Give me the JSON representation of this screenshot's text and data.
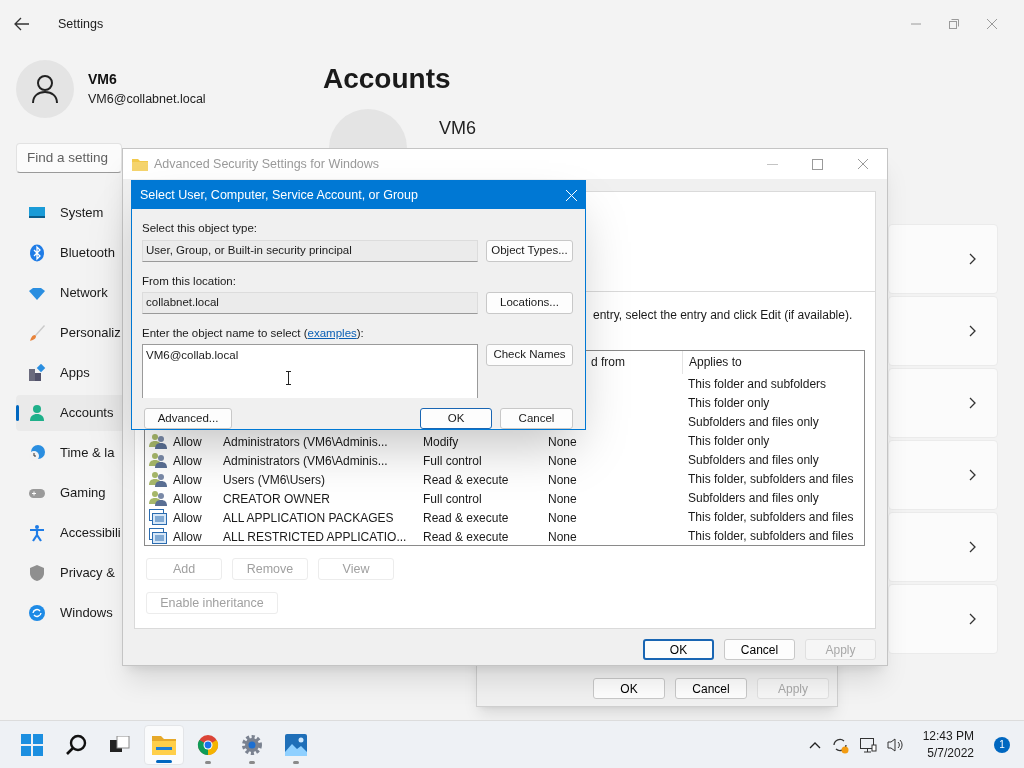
{
  "settings": {
    "title": "Settings",
    "user": {
      "name": "VM6",
      "email": "VM6@collabnet.local"
    },
    "search": {
      "placeholder": "Find a setting"
    },
    "nav": [
      {
        "label": "System",
        "selected": false
      },
      {
        "label": "Bluetooth",
        "selected": false
      },
      {
        "label": "Network",
        "selected": false
      },
      {
        "label": "Personaliz",
        "selected": false
      },
      {
        "label": "Apps",
        "selected": false
      },
      {
        "label": "Accounts",
        "selected": true
      },
      {
        "label": "Time & la",
        "selected": false
      },
      {
        "label": "Gaming",
        "selected": false
      },
      {
        "label": "Accessibili",
        "selected": false
      },
      {
        "label": "Privacy &",
        "selected": false
      },
      {
        "label": "Windows",
        "selected": false
      }
    ],
    "heading": "Accounts",
    "profile_name": "VM6"
  },
  "back_dialog": {
    "buttons": [
      {
        "label": "OK",
        "disabled": false,
        "default": false
      },
      {
        "label": "Cancel",
        "disabled": false,
        "default": false
      },
      {
        "label": "Apply",
        "disabled": true,
        "default": false
      }
    ]
  },
  "advanced_window": {
    "title": "Advanced Security Settings for Windows",
    "instruction": "entry, select the entry and click Edit (if available).",
    "columns": [
      "d from",
      "Applies to"
    ],
    "rows": [
      {
        "applies_to": "This folder and subfolders"
      },
      {
        "applies_to": "This folder only"
      },
      {
        "applies_to": "Subfolders and files only"
      },
      {
        "kind": "group",
        "type": "Allow",
        "principal": "Administrators (VM6\\Adminis...",
        "access": "Modify",
        "inherited": "None",
        "applies_to": "This folder only"
      },
      {
        "kind": "group",
        "type": "Allow",
        "principal": "Administrators (VM6\\Adminis...",
        "access": "Full control",
        "inherited": "None",
        "applies_to": "Subfolders and files only"
      },
      {
        "kind": "group",
        "type": "Allow",
        "principal": "Users (VM6\\Users)",
        "access": "Read & execute",
        "inherited": "None",
        "applies_to": "This folder, subfolders and files"
      },
      {
        "kind": "group",
        "type": "Allow",
        "principal": "CREATOR OWNER",
        "access": "Full control",
        "inherited": "None",
        "applies_to": "Subfolders and files only"
      },
      {
        "kind": "package",
        "type": "Allow",
        "principal": "ALL APPLICATION PACKAGES",
        "access": "Read & execute",
        "inherited": "None",
        "applies_to": "This folder, subfolders and files"
      },
      {
        "kind": "package",
        "type": "Allow",
        "principal": "ALL RESTRICTED APPLICATIO...",
        "access": "Read & execute",
        "inherited": "None",
        "applies_to": "This folder, subfolders and files"
      }
    ],
    "row_buttons": [
      {
        "label": "Add",
        "disabled": true
      },
      {
        "label": "Remove",
        "disabled": true
      },
      {
        "label": "View",
        "disabled": true
      }
    ],
    "inheritance_button": {
      "label": "Enable inheritance",
      "disabled": true
    },
    "buttons": [
      {
        "label": "OK",
        "disabled": false,
        "default": true
      },
      {
        "label": "Cancel",
        "disabled": false,
        "default": false
      },
      {
        "label": "Apply",
        "disabled": true,
        "default": false
      }
    ]
  },
  "select_dialog": {
    "title": "Select User, Computer, Service Account, or Group",
    "object_type": {
      "label": "Select this object type:",
      "value": "User, Group, or Built-in security principal",
      "button": "Object Types..."
    },
    "location": {
      "label": "From this location:",
      "value": "collabnet.local",
      "button": "Locations..."
    },
    "object_name": {
      "label_before": "Enter the object name to select (",
      "link": "examples",
      "label_after": "):",
      "value": "VM6@collab.local",
      "button": "Check Names"
    },
    "advanced_button": "Advanced...",
    "ok_button": "OK",
    "cancel_button": "Cancel"
  },
  "taskbar": {
    "apps": [
      {
        "open": false,
        "active": false
      },
      {
        "open": false,
        "active": false
      },
      {
        "open": false,
        "active": false
      },
      {
        "open": true,
        "active": true
      },
      {
        "open": true,
        "active": false
      },
      {
        "open": true,
        "active": false
      },
      {
        "open": true,
        "active": false
      }
    ],
    "time": "12:43 PM",
    "date": "5/7/2022",
    "notifications": "1"
  }
}
